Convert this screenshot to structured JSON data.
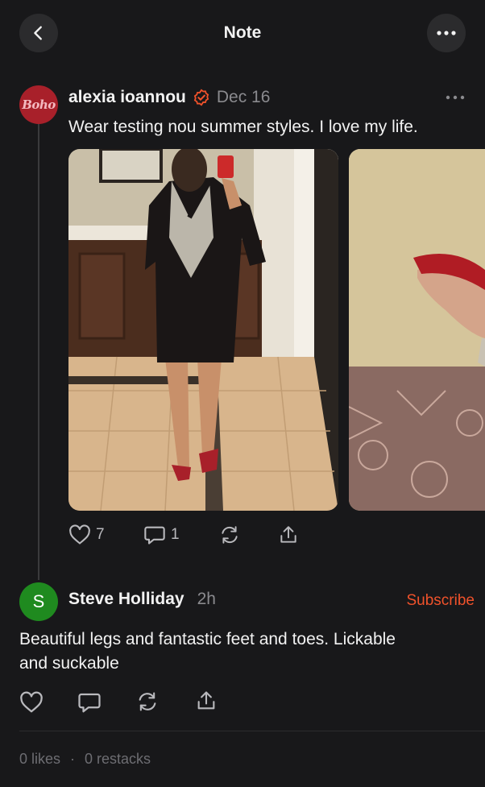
{
  "header": {
    "title": "Note",
    "back_icon": "chevron-left-icon",
    "more_icon": "more-horizontal-icon"
  },
  "post": {
    "avatar_text": "Boho",
    "author": "alexia ioannou",
    "verified_icon": "verified-badge-icon",
    "date": "Dec 16",
    "text": "Wear testing nou summer styles. I love my life.",
    "likes": "7",
    "comments": "1",
    "accent_color": "#f0522b"
  },
  "reply": {
    "avatar_letter": "S",
    "author": "Steve Holliday",
    "time": "2h",
    "subscribe_label": "Subscribe",
    "text_line1": "Beautiful legs and fantastic feet and toes. Lickable",
    "text_line2": "and suckable",
    "likes_text": "0 likes",
    "separator": "·",
    "restacks_text": "0 restacks"
  }
}
